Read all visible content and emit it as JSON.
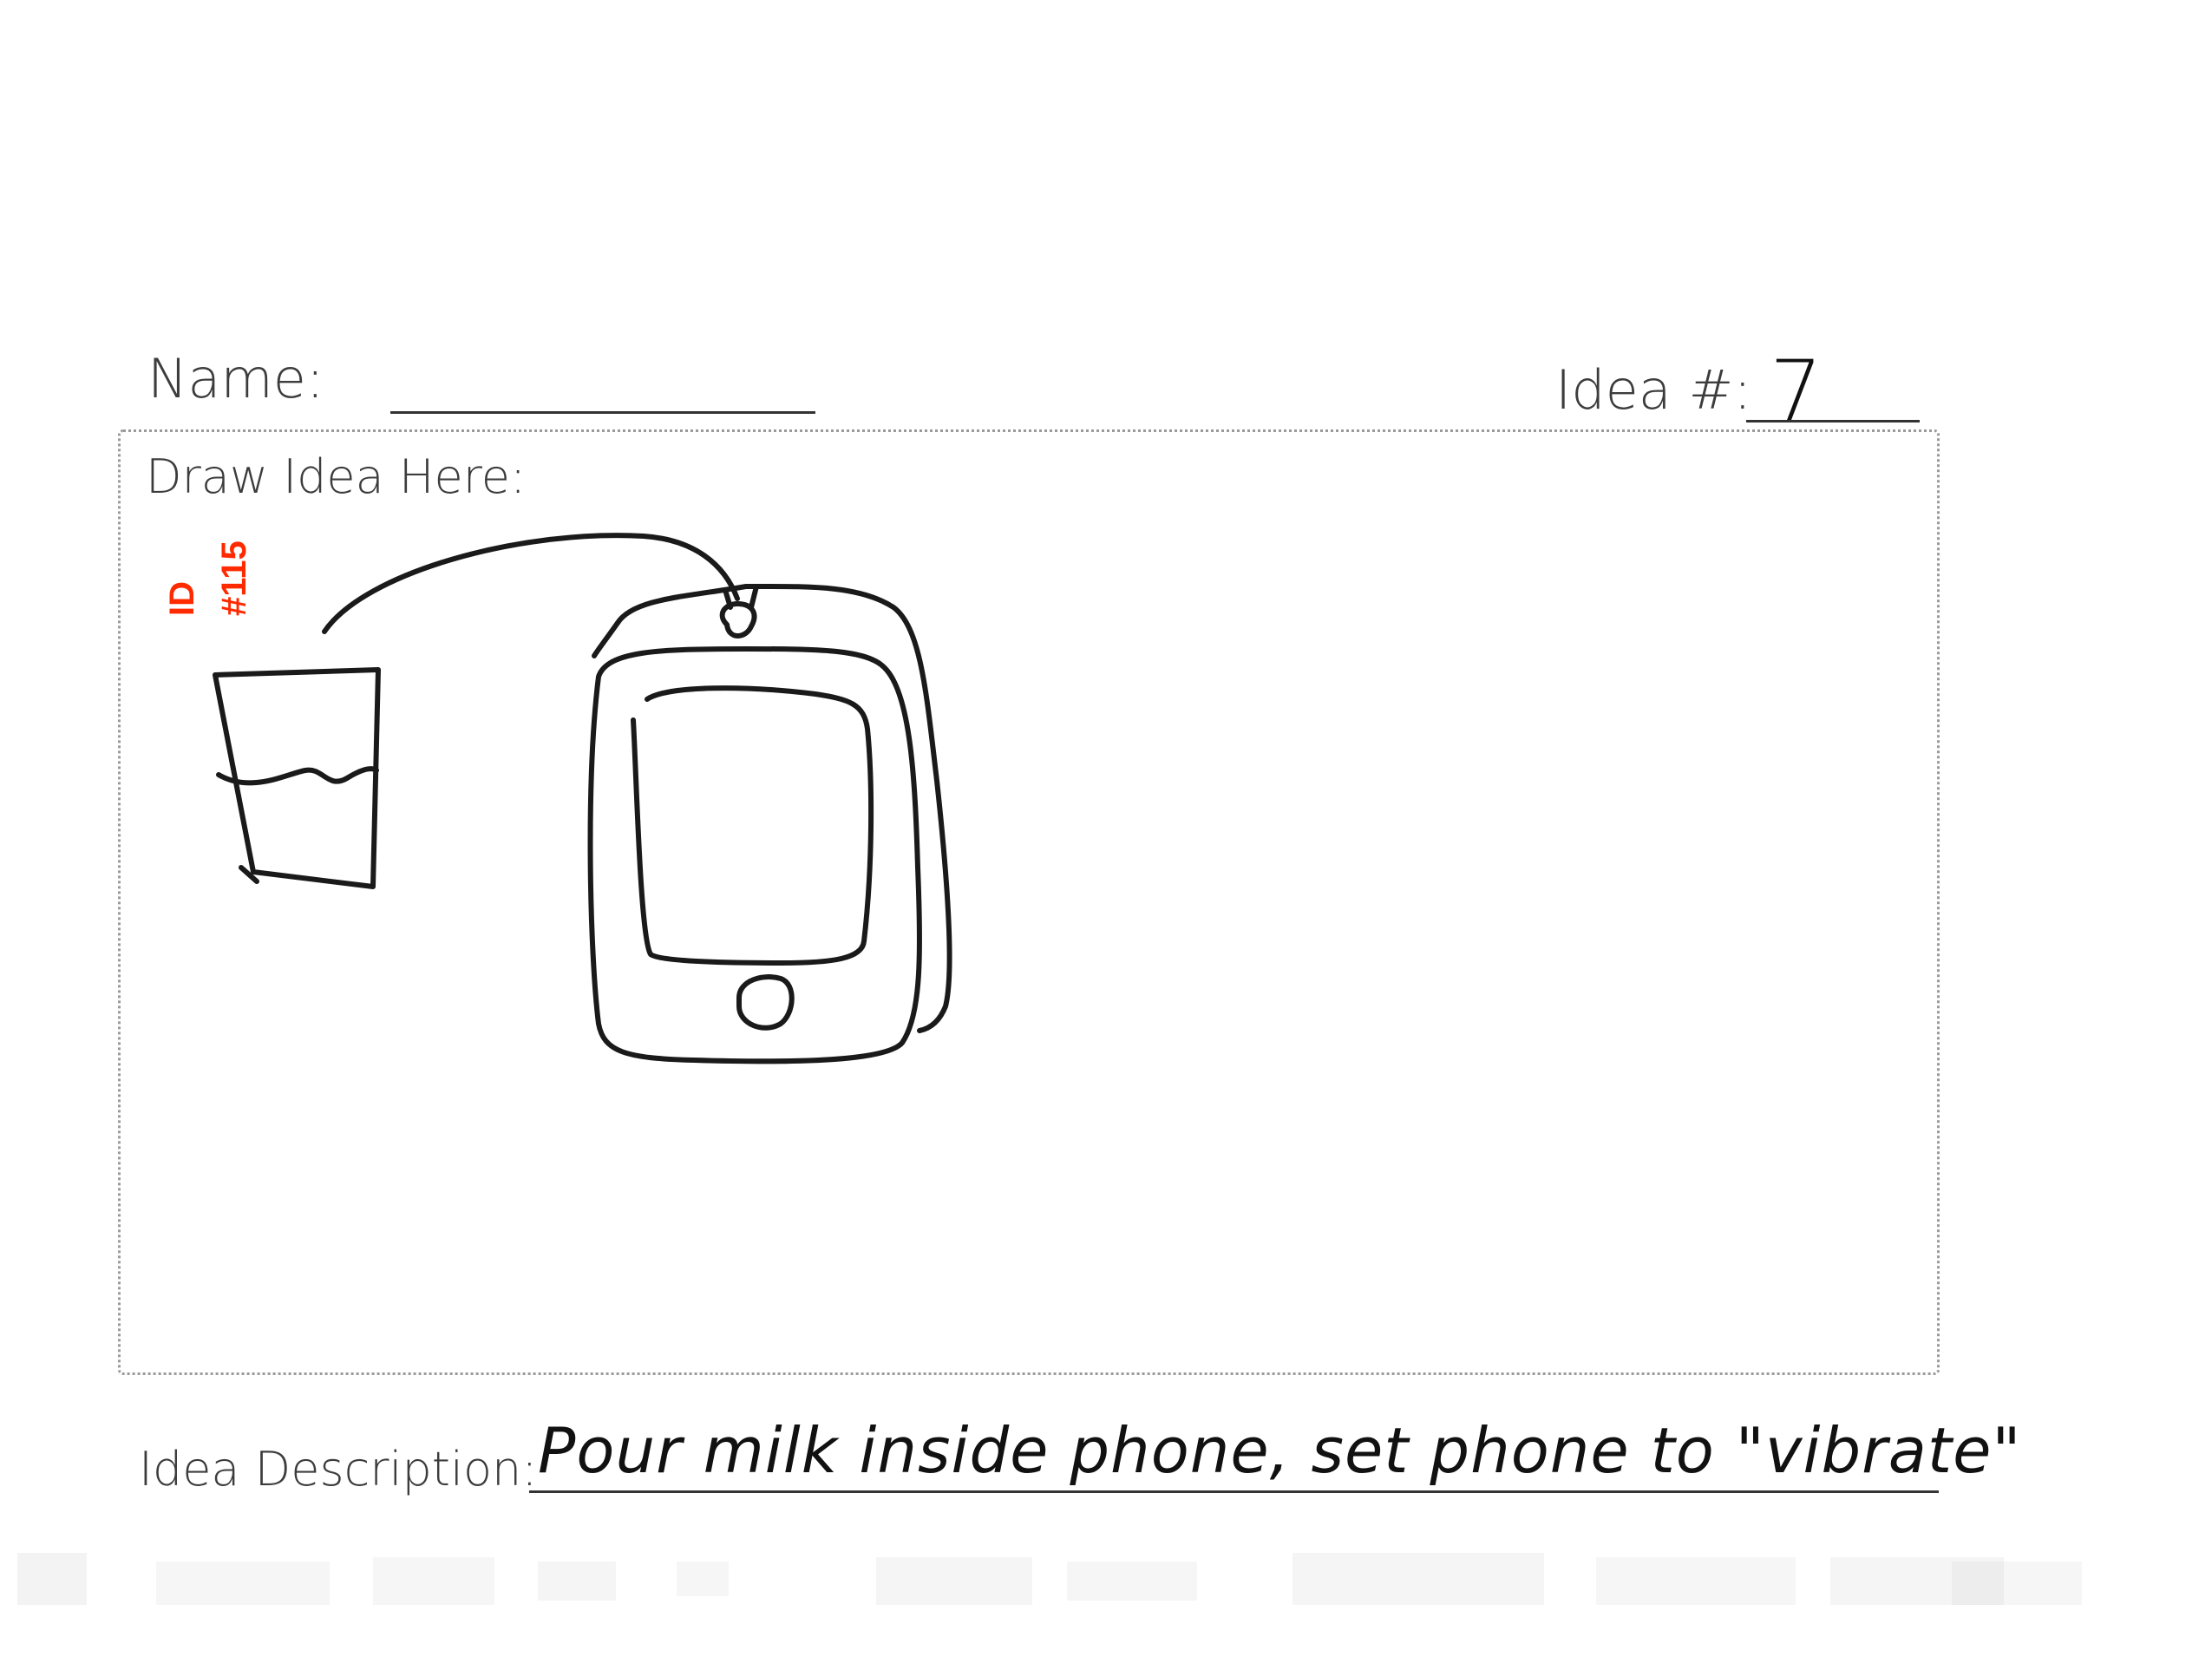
{
  "form": {
    "name_label": "Name:",
    "idea_number_label": "Idea #:",
    "idea_number_value": "7",
    "draw_label": "Draw Idea Here:",
    "description_label": "Idea Description:",
    "description_value": "Pour milk inside phone, set phone to \"vibrate\""
  },
  "stamp": {
    "line1": "ID",
    "line2": "#115",
    "color": "#ff2a00"
  },
  "sketch": {
    "objects": [
      "milk-glass",
      "phone-case",
      "phone",
      "cable"
    ]
  }
}
